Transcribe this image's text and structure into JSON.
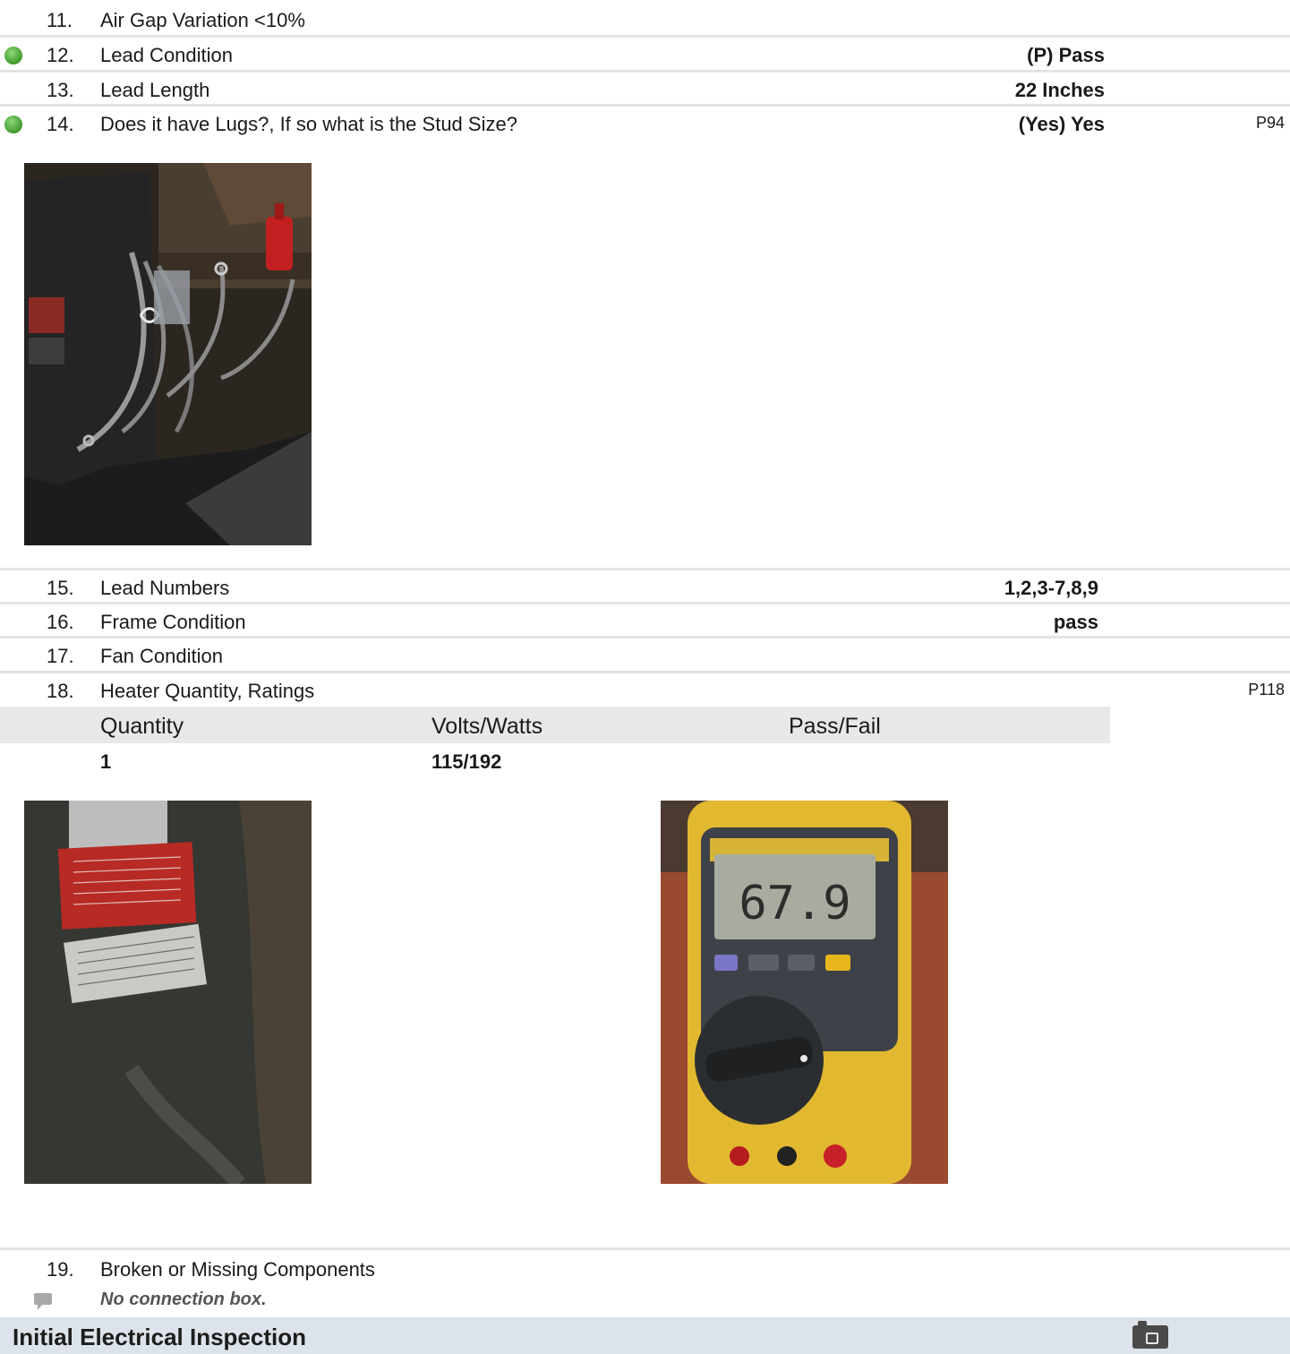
{
  "items": [
    {
      "num": "11.",
      "label": "Air Gap Variation <10%",
      "value": "",
      "ref": "",
      "status": ""
    },
    {
      "num": "12.",
      "label": "Lead Condition",
      "value": "(P) Pass",
      "ref": "",
      "status": "green"
    },
    {
      "num": "13.",
      "label": "Lead Length",
      "value": "22 Inches",
      "ref": "",
      "status": ""
    },
    {
      "num": "14.",
      "label": "Does it have Lugs?, If so what is the Stud Size?",
      "value": "(Yes) Yes",
      "ref": "P94",
      "status": "green"
    },
    {
      "num": "15.",
      "label": "Lead Numbers",
      "value": "1,2,3-7,8,9",
      "ref": "",
      "status": ""
    },
    {
      "num": "16.",
      "label": "Frame Condition",
      "value": "pass",
      "ref": "",
      "status": ""
    },
    {
      "num": "17.",
      "label": "Fan Condition",
      "value": "",
      "ref": "",
      "status": ""
    },
    {
      "num": "18.",
      "label": "Heater Quantity, Ratings",
      "value": "",
      "ref": "P118",
      "status": ""
    },
    {
      "num": "19.",
      "label": "Broken or Missing Components",
      "value": "",
      "ref": "",
      "status": ""
    }
  ],
  "heater_table": {
    "headers": [
      "Quantity",
      "Volts/Watts",
      "Pass/Fail"
    ],
    "row": [
      "1",
      "115/192",
      ""
    ]
  },
  "comment": "No connection box.",
  "section": {
    "title": "Initial Electrical Inspection"
  },
  "colors": {
    "status_green": "#4caf3a",
    "section_bg": "#dde3ea",
    "subhead_bg": "#e8e8e8"
  }
}
